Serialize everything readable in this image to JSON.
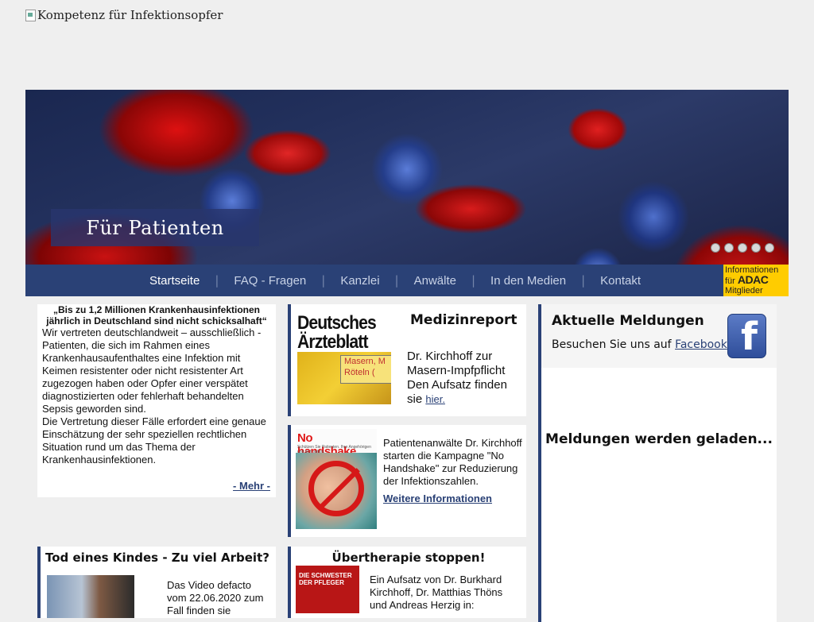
{
  "header": {
    "logo_alt": "Kompetenz für Infektionsopfer"
  },
  "hero": {
    "label": "Für Patienten",
    "dots": 5
  },
  "nav": {
    "items": [
      "Startseite",
      "FAQ - Fragen",
      "Kanzlei",
      "Anwälte",
      "In den Medien",
      "Kontakt"
    ],
    "active_index": 0,
    "adac": {
      "line1": "Informationen",
      "line2": "für",
      "brand": "ADAC",
      "line3": "Mitglieder"
    }
  },
  "intro": {
    "heading": "„Bis zu 1,2 Millionen Krankenhausinfektionen jährlich in Deutschland sind nicht schicksalhaft“",
    "p1": "Wir vertreten deutschlandweit – ausschließlich - Patienten, die sich im Rahmen eines Krankenhausaufenthaltes eine Infektion mit Keimen resistenter oder nicht resistenter Art zugezogen haben oder Opfer einer verspätet diagnostizierten oder fehlerhaft behandelten Sepsis geworden sind.",
    "p2": "Die Vertretung dieser Fälle erfordert eine genaue Einschätzung der sehr speziellen rechtlichen Situation rund um das Thema der Krankenhausinfektionen.",
    "more": "- Mehr -"
  },
  "medizinreport": {
    "title": "Medizinreport",
    "logo_line1": "Deutsches",
    "logo_line2": "Ärzteblatt",
    "sign_line1": "Masern, M",
    "sign_line2": "Röteln (",
    "text": "Dr. Kirchhoff zur Masern-Impfpflicht Den Aufsatz finden sie",
    "link": "hier."
  },
  "no_handshake": {
    "img_title": "No handshake.",
    "img_sub": "Schützen Sie Patienten. Ihre Angehörigen und sich selbst.",
    "text": "Patientenanwälte Dr. Kirchhoff starten die Kampagne \"No Handshake\" zur Reduzierung der Infektionszahlen.",
    "link": "Weitere Informationen"
  },
  "news": {
    "title": "Aktuelle Meldungen",
    "sub_prefix": "Besuchen Sie uns auf",
    "sub_link": "Facebook",
    "loading": "Meldungen werden geladen..."
  },
  "tod": {
    "title": "Tod eines Kindes - Zu viel Arbeit?",
    "text": "Das Video defacto vom 22.06.2020 zum Fall finden sie"
  },
  "uebertherapie": {
    "title": "Übertherapie stoppen!",
    "img_text": "DIE SCHWESTER DER PFLEGER",
    "text": "Ein Aufsatz von Dr. Burkhard Kirchhoff, Dr. Matthias Thöns und Andreas Herzig in:"
  },
  "colors": {
    "nav_bg": "#2a4176",
    "adac_yellow": "#ffcc00",
    "accent_red": "#e01818"
  }
}
